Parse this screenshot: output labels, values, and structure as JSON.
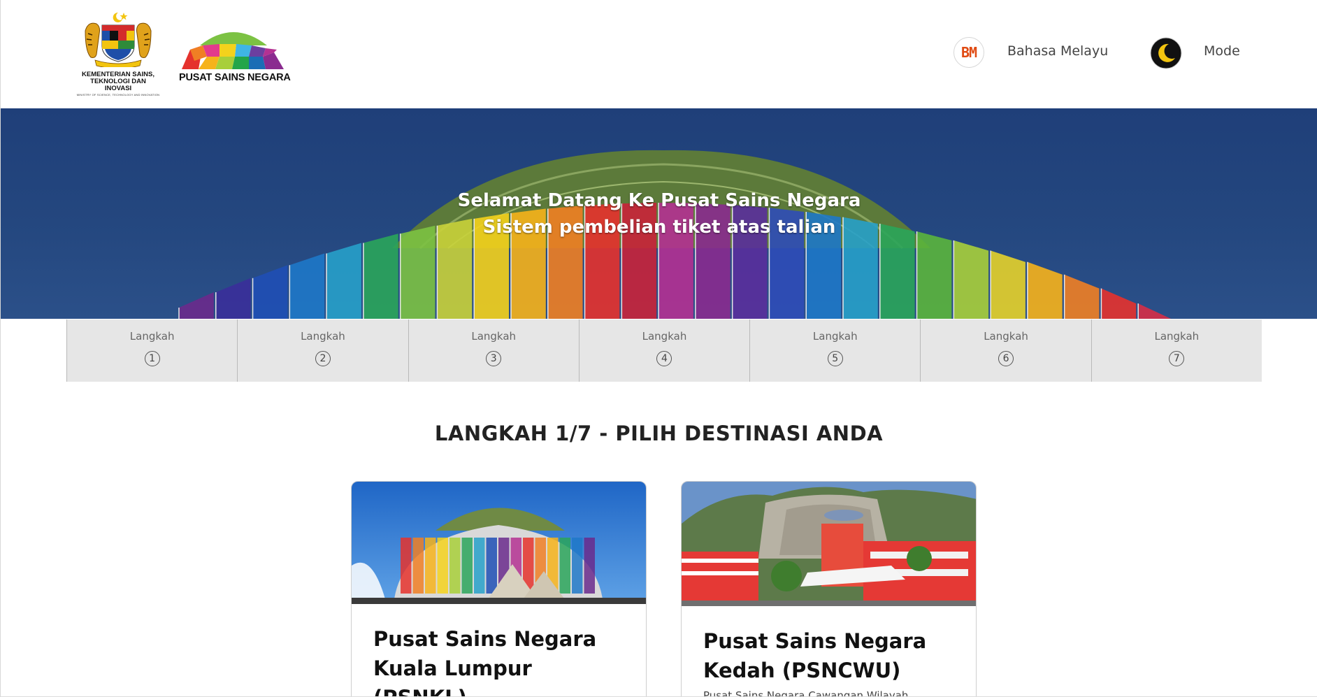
{
  "header": {
    "ministry_logo_text": "KEMENTERIAN SAINS, TEKNOLOGI DAN INOVASI",
    "ministry_logo_subtext": "MINISTRY OF SCIENCE, TECHNOLOGY AND INNOVATION",
    "brand_name": "PUSAT SAINS NEGARA",
    "language_code": "BM",
    "language_label": "Bahasa Melayu",
    "mode_label": "Mode"
  },
  "hero": {
    "line1": "Selamat Datang Ke Pusat Sains Negara",
    "line2": "Sistem pembelian tiket atas talian"
  },
  "steps": [
    {
      "label": "Langkah",
      "number": "1"
    },
    {
      "label": "Langkah",
      "number": "2"
    },
    {
      "label": "Langkah",
      "number": "3"
    },
    {
      "label": "Langkah",
      "number": "4"
    },
    {
      "label": "Langkah",
      "number": "5"
    },
    {
      "label": "Langkah",
      "number": "6"
    },
    {
      "label": "Langkah",
      "number": "7"
    }
  ],
  "section_title": "LANGKAH 1/7 - PILIH DESTINASI ANDA",
  "destinations": [
    {
      "title": "Pusat Sains Negara Kuala Lumpur (PSNKL)",
      "description": ""
    },
    {
      "title": "Pusat Sains Negara Kedah (PSNCWU)",
      "description": "Pusat Sains Negara Cawangan Wilayah"
    }
  ],
  "colors": {
    "hero_sky": "#24477f",
    "step_bg": "#e6e6e6",
    "lang_accent": "#e04a12",
    "mode_icon_bg": "#111111",
    "mode_icon_moon": "#f2c40f"
  }
}
